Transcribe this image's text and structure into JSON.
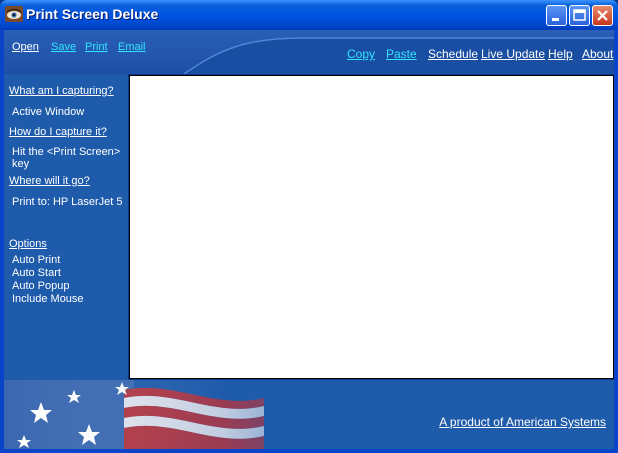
{
  "window": {
    "title": "Print Screen Deluxe",
    "colors": {
      "titlebar": "#0054e3",
      "panel": "#1f5bab",
      "link_cyan": "#33e3ff"
    }
  },
  "toolbar": {
    "left": [
      {
        "label": "Open",
        "color": "white"
      },
      {
        "label": "Save",
        "color": "cyan"
      },
      {
        "label": "Print",
        "color": "cyan"
      },
      {
        "label": "Email",
        "color": "cyan"
      }
    ],
    "right": [
      {
        "label": "Copy",
        "color": "cyan"
      },
      {
        "label": "Paste",
        "color": "cyan"
      },
      {
        "label": "Schedule",
        "color": "white"
      },
      {
        "label": "Live Update",
        "color": "white"
      },
      {
        "label": "Help",
        "color": "white"
      },
      {
        "label": "About",
        "color": "white"
      }
    ]
  },
  "sidebar": {
    "q_what": "What am I capturing?",
    "a_what": "Active Window",
    "q_how": "How do I capture it?",
    "a_how_1": "Hit the <Print Screen>",
    "a_how_2": "key",
    "q_where": "Where will it go?",
    "a_where": "Print to: HP LaserJet 5",
    "options_title": "Options",
    "options": [
      "Auto Print",
      "Auto Start",
      "Auto Popup",
      "Include Mouse"
    ]
  },
  "footer": {
    "link": "A product of American Systems"
  }
}
